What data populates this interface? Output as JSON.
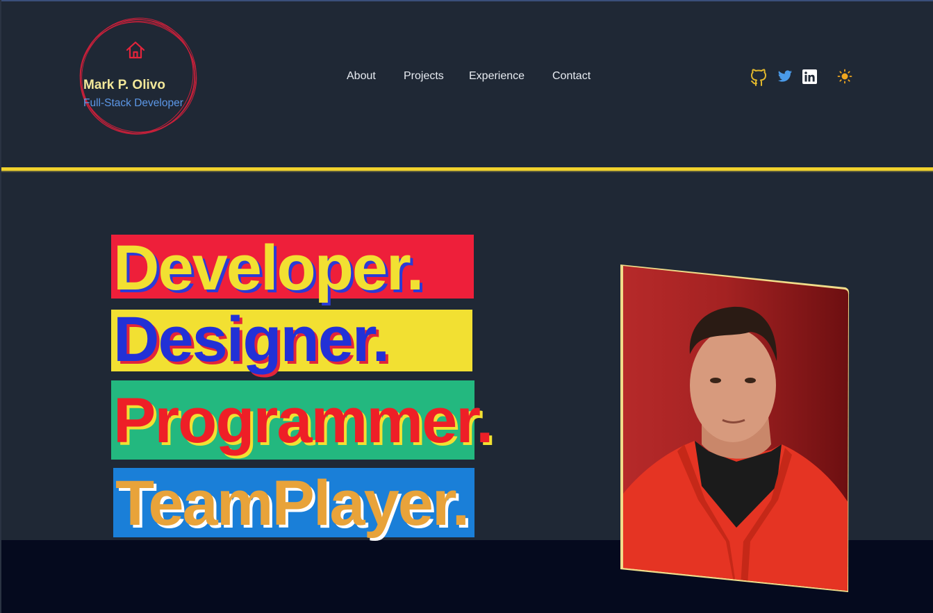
{
  "brand": {
    "name": "Mark P. Olivo",
    "role": "Full-Stack Developer",
    "icon": "home-icon"
  },
  "nav": {
    "items": [
      {
        "label": "About"
      },
      {
        "label": "Projects"
      },
      {
        "label": "Experience"
      },
      {
        "label": "Contact"
      }
    ]
  },
  "social": {
    "icons": [
      "github-icon",
      "twitter-icon",
      "linkedin-icon",
      "sun-icon"
    ]
  },
  "hero": {
    "words": [
      {
        "text": "Developer.",
        "text_color": "#f2e032",
        "shadow_color": "#2a3bd6",
        "bg_color": "#ee1f3a"
      },
      {
        "text": "Designer.",
        "text_color": "#2231d6",
        "shadow_color": "#e3243b",
        "bg_color": "#f2e032"
      },
      {
        "text": "Programmer.",
        "text_color": "#ee1f27",
        "shadow_color": "#f2e032",
        "bg_color": "#23b87f"
      },
      {
        "text": "TeamPlayer.",
        "text_color": "#e8a33a",
        "shadow_color": "#ffffff",
        "bg_color": "#1a7fd8"
      }
    ],
    "photo_alt": "profile-photo"
  },
  "colors": {
    "background": "#1f2835",
    "accent_yellow": "#f1d22c",
    "brand_name": "#f3e89a",
    "brand_role": "#5c97e6",
    "logo_ring": "#c8203a",
    "bottom_band": "#050a1e"
  }
}
